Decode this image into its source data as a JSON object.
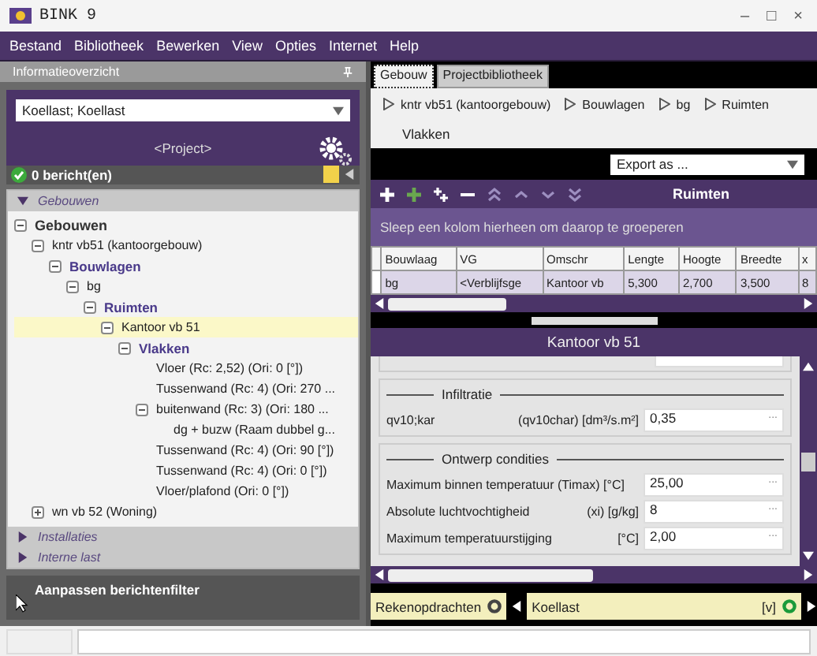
{
  "window": {
    "title": "BINK  9",
    "controls": [
      "–",
      "□",
      "×"
    ]
  },
  "menu": [
    "Bestand",
    "Bibliotheek",
    "Bewerken",
    "View",
    "Opties",
    "Internet",
    "Help"
  ],
  "left": {
    "panel_title": "Informatieoverzicht",
    "combo_value": "Koellast; Koellast",
    "project": "<Project>",
    "messages": "0 bericht(en)",
    "sections": [
      {
        "label": "Gebouwen",
        "expanded": true
      },
      {
        "label": "Installaties",
        "expanded": false
      },
      {
        "label": "Interne last",
        "expanded": false
      }
    ],
    "tree": [
      {
        "label": "Gebouwen",
        "kind": "root",
        "expanded": true,
        "selected": false,
        "children": [
          {
            "label": "kntr vb51 (kantoorgebouw)",
            "kind": "item",
            "expanded": true,
            "selected": false,
            "children": [
              {
                "label": "Bouwlagen",
                "kind": "group",
                "expanded": true,
                "selected": false,
                "children": [
                  {
                    "label": "bg",
                    "kind": "item",
                    "expanded": true,
                    "selected": false,
                    "children": [
                      {
                        "label": "Ruimten",
                        "kind": "group",
                        "expanded": true,
                        "selected": false,
                        "children": [
                          {
                            "label": "Kantoor vb 51",
                            "kind": "item",
                            "expanded": true,
                            "selected": true,
                            "children": [
                              {
                                "label": "Vlakken",
                                "kind": "group",
                                "expanded": true,
                                "selected": false,
                                "children": [
                                  {
                                    "label": "Vloer (Rc: 2,52) (Ori: 0 [°])",
                                    "kind": "item",
                                    "selected": false
                                  },
                                  {
                                    "label": "Tussenwand (Rc: 4) (Ori: 270 ...",
                                    "kind": "item",
                                    "selected": false
                                  },
                                  {
                                    "label": "buitenwand  (Rc: 3) (Ori: 180 ...",
                                    "kind": "item",
                                    "expanded": true,
                                    "selected": false,
                                    "children": [
                                      {
                                        "label": "dg + buzw (Raam dubbel g...",
                                        "kind": "item",
                                        "selected": false
                                      }
                                    ]
                                  },
                                  {
                                    "label": "Tussenwand (Rc: 4) (Ori: 90 [°])",
                                    "kind": "item",
                                    "selected": false
                                  },
                                  {
                                    "label": "Tussenwand (Rc: 4) (Ori: 0 [°])",
                                    "kind": "item",
                                    "selected": false
                                  },
                                  {
                                    "label": "Vloer/plafond (Ori: 0 [°])",
                                    "kind": "item",
                                    "selected": false
                                  }
                                ]
                              }
                            ]
                          }
                        ]
                      }
                    ]
                  }
                ]
              }
            ]
          },
          {
            "label": "wn vb 52 (Woning)",
            "kind": "item",
            "expanded": false,
            "selected": false
          }
        ]
      }
    ],
    "filter": "Aanpassen berichtenfilter"
  },
  "right": {
    "tabs": [
      {
        "label": "Gebouw",
        "selected": true
      },
      {
        "label": "Projectbibliotheek",
        "selected": false
      }
    ],
    "breadcrumb": [
      "kntr vb51 (kantoorgebouw)",
      "Bouwlagen",
      "bg",
      "Ruimten"
    ],
    "breadcrumb_last": "Vlakken",
    "export": "Export as ...",
    "grid_title": "Ruimten",
    "group_hint": "Sleep een kolom hierheen om daarop te groeperen",
    "table": {
      "columns": [
        "Bouwlaag",
        "VG",
        "Omschr",
        "Lengte",
        "Hoogte",
        "Breedte",
        "x"
      ],
      "rows": [
        [
          "bg",
          "<Verblijfsge",
          "Kantoor vb",
          "5,300",
          "2,700",
          "3,500",
          "8"
        ]
      ]
    },
    "detail_title": "Kantoor vb 51",
    "sections": [
      {
        "title": "Infiltratie",
        "fields": [
          {
            "label": "qv10;kar",
            "unit": "(qv10char) [dm³/s.m²]",
            "value": "0,35"
          }
        ]
      },
      {
        "title": "Ontwerp condities",
        "fields": [
          {
            "label": "Maximum binnen temperatuur (Timax) [°C]",
            "value": "25,00"
          },
          {
            "label": "Absolute luchtvochtigheid",
            "unit": "(xi) [g/kg]",
            "value": "8"
          },
          {
            "label": "Maximum temperatuurstijging",
            "unit": "[°C]",
            "value": "2,00"
          }
        ]
      }
    ],
    "ellipsis": "...",
    "tasks_label": "Rekenopdrachten",
    "task": "Koellast",
    "task_flag": "[v]"
  }
}
